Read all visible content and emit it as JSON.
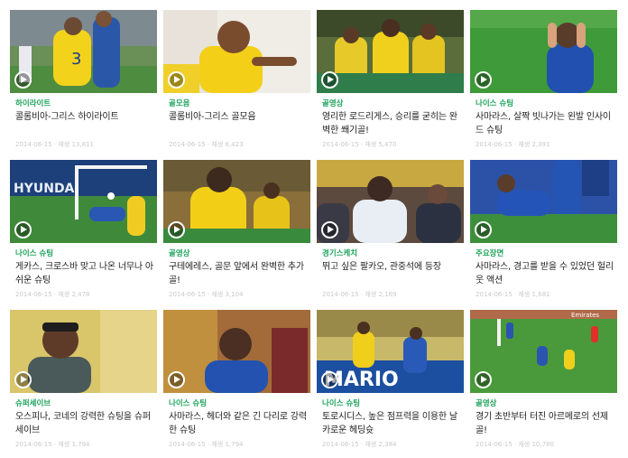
{
  "cards": [
    {
      "category": "하이라이트",
      "title": "콜롬비아-그리스 하이라이트",
      "meta": "2014-06-15 · 재생 13,811"
    },
    {
      "category": "골모음",
      "title": "콜롬비아-그리스 골모음",
      "meta": "2014-06-15 · 재생 6,423"
    },
    {
      "category": "골영상",
      "title": "영리한 로드리게스, 승리를 굳히는 완벽한 쐐기골!",
      "meta": "2014-06-15 · 재생 5,470"
    },
    {
      "category": "나이스 슈팅",
      "title": "사마라스, 살짝 빗나가는 왼발 인사이드 슈팅",
      "meta": "2014-06-15 · 재생 2,391"
    },
    {
      "category": "나이스 슈팅",
      "title": "게카스, 크로스바 맞고 나온 너무나 아쉬운 슈팅",
      "meta": "2014-06-15 · 재생 2,478"
    },
    {
      "category": "골영상",
      "title": "구테에레스, 골문 앞에서 완벽한 추가골!",
      "meta": "2014-06-15 · 재생 3,104"
    },
    {
      "category": "경기스케치",
      "title": "뛰고 싶은 팔카오, 관중석에 등장",
      "meta": "2014-06-15 · 재생 2,169"
    },
    {
      "category": "주요장면",
      "title": "사마라스, 경고를 받을 수 있었던 헐리웃 액션",
      "meta": "2014-06-15 · 재생 1,681"
    },
    {
      "category": "슈퍼세이브",
      "title": "오스피나, 코네의 강력한 슈팅을 슈퍼세이브",
      "meta": "2014-06-15 · 재생 1,794"
    },
    {
      "category": "나이스 슈팅",
      "title": "사마라스, 헤더와 같은 긴 다리로 강력한 슈팅",
      "meta": "2014-06-15 · 재생 1,794"
    },
    {
      "category": "나이스 슈팅",
      "title": "토로시디스, 높은 점프력을 이용한 날카로운 헤딩슛",
      "meta": "2014-06-15 · 재생 2,384"
    },
    {
      "category": "골영상",
      "title": "경기 초반부터 터진 아르메로의 선제골!",
      "meta": "2014-06-15 · 재생 10,780"
    }
  ],
  "colors": {
    "category": "#1aa35a",
    "title": "#222222",
    "meta": "#c9c9c9"
  },
  "icons": {
    "play": "play-circle-icon"
  }
}
